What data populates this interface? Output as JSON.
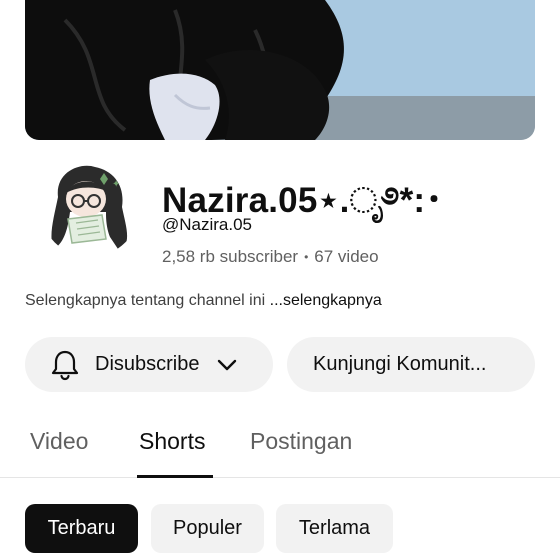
{
  "channel": {
    "name": "Nazira.05⋆.ೃ࿔*:･",
    "handle": "@Nazira.05",
    "subscribers": "2,58 rb subscriber",
    "separator": "•",
    "videos": "67 video",
    "about_text": "Selengkapnya tentang channel ini ",
    "about_more": "...selengkapnya"
  },
  "actions": {
    "subscribe_label": "Disubscribe",
    "community_label": "Kunjungi Komunit..."
  },
  "tabs": [
    {
      "label": "Video",
      "active": false
    },
    {
      "label": "Shorts",
      "active": true
    },
    {
      "label": "Postingan",
      "active": false
    }
  ],
  "filters": [
    {
      "label": "Terbaru",
      "active": true
    },
    {
      "label": "Populer",
      "active": false
    },
    {
      "label": "Terlama",
      "active": false
    }
  ],
  "icons": {
    "bell": "bell-icon",
    "dropdown": "chevron-down-icon"
  },
  "colors": {
    "text": "#0f0f0f",
    "secondary_text": "#606060",
    "chip_bg": "#f2f2f2",
    "active_chip_bg": "#0f0f0f"
  }
}
